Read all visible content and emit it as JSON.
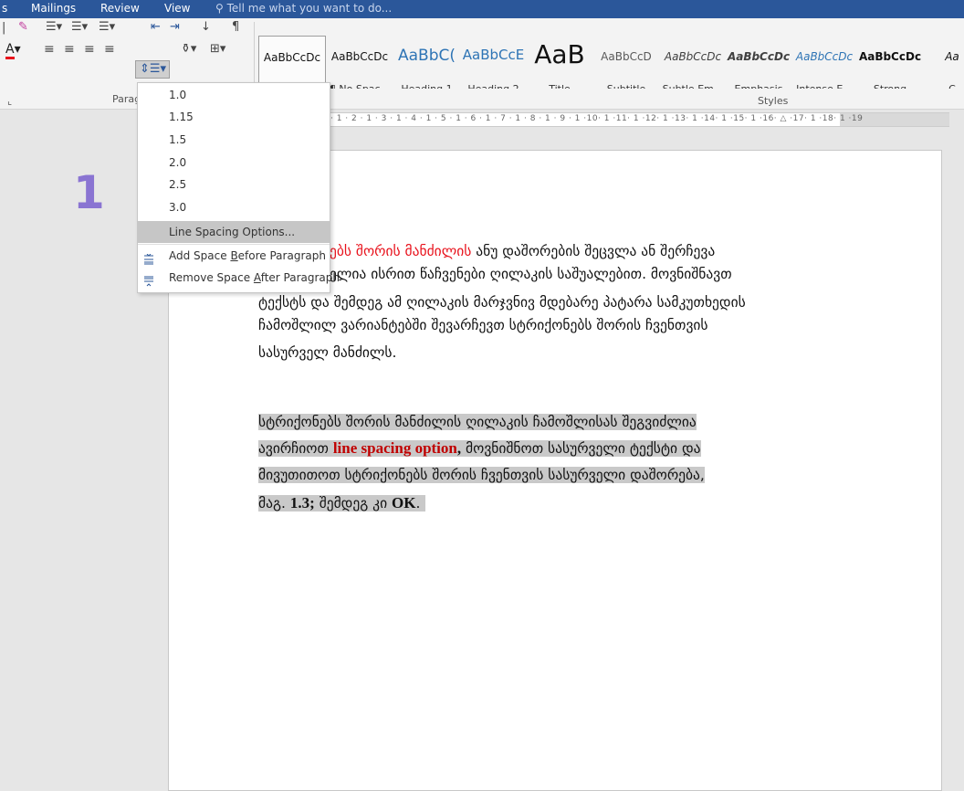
{
  "menu": {
    "items": [
      "s",
      "Mailings",
      "Review",
      "View"
    ],
    "tell_me": "Tell me what you want to do..."
  },
  "ribbon": {
    "paragraph_group_label": "Parag",
    "styles_group_label": "Styles",
    "styles": [
      {
        "sample": "AaBbCcDc",
        "name": "¶ Normal"
      },
      {
        "sample": "AaBbCcDc",
        "name": "¶ No Spac..."
      },
      {
        "sample": "AaBbC(",
        "name": "Heading 1"
      },
      {
        "sample": "AaBbCcE",
        "name": "Heading 2"
      },
      {
        "sample": "AaB",
        "name": "Title"
      },
      {
        "sample": "AaBbCcD",
        "name": "Subtitle"
      },
      {
        "sample": "AaBbCcDc",
        "name": "Subtle Em..."
      },
      {
        "sample": "AaBbCcDc",
        "name": "Emphasis"
      },
      {
        "sample": "AaBbCcDc",
        "name": "Intense E..."
      },
      {
        "sample": "AaBbCcDc",
        "name": "Strong"
      },
      {
        "sample": "Aa",
        "name": "C"
      }
    ]
  },
  "ruler": {
    "text": "· 1 · 2 · 1 · 3 · 1 · 4 · 1 · 5 · 1 · 6 · 1 · 7 · 1 · 8 · 1 · 9 · 1 ·10· 1 ·11· 1 ·12· 1 ·13· 1 ·14· 1 ·15· 1 ·16· △ ·17· 1 ·18· 1 ·19"
  },
  "step_number": "1",
  "dropdown": {
    "spacing_options": [
      "1.0",
      "1.15",
      "1.5",
      "2.0",
      "2.5",
      "3.0"
    ],
    "line_spacing_options": "Line Spacing Options...",
    "add_space_before_pre": "Add Space ",
    "add_space_before_ul": "B",
    "add_space_before_post": "efore Paragraph",
    "remove_space_after_pre": "Remove Space ",
    "remove_space_after_ul": "A",
    "remove_space_after_post": "fter Paragraph"
  },
  "document": {
    "p1_line1_red": "ებს შორის მანძილის",
    "p1_line1_rest": " ანუ დაშორების შეცვლა ან შერჩევა",
    "p1_line2": "ელია ისრით წაჩვენები  ღილაკის საშუალებით. მოვნიშნავთ",
    "p1_line3": "ტექსტს და შემდეგ ამ ღილაკის მარჯვნივ მდებარე პატარა სამკუთხედის",
    "p1_line4": "ჩამოშლილ ვარიანტებში შევარჩევთ სტრიქონებს შორის ჩვენთვის",
    "p1_line5": "სასურველ მანძილს.",
    "p2_line1": "სტრიქონებს შორის მანძილის ღილაკის ჩამოშლისას შეგვიძლია",
    "p2_line2_pre": "ავირჩიოთ ",
    "p2_line2_red": "line spacing option",
    "p2_line2_comma": ",",
    "p2_line2_post": " მოვნიშნოთ სასურველი ტექსტი და",
    "p2_line3": "მივუთითოთ სტრიქონებს შორის ჩვენთვის სასურველი დაშორება,",
    "p2_line4_pre": "მაგ.  ",
    "p2_line4_b1": "1.3;",
    "p2_line4_mid": "  შემდეგ კი  ",
    "p2_line4_b2": "OK",
    "p2_line4_end": "."
  },
  "colors": {
    "menubar": "#2b579a",
    "accent_red": "#e8121c",
    "step_number": "#8a74d2",
    "selection": "#c9c9c9"
  }
}
